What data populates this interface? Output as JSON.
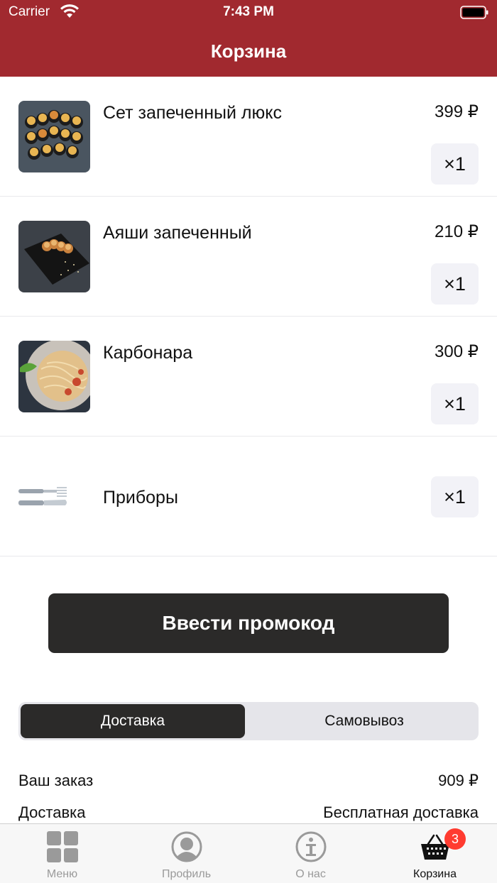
{
  "status_bar": {
    "carrier": "Carrier",
    "time": "7:43 PM"
  },
  "header": {
    "title": "Корзина"
  },
  "cart": {
    "items": [
      {
        "name": "Сет запеченный люкс",
        "price": "399 ₽",
        "quantity": "×1",
        "image": "baked-sushi-set-photo"
      },
      {
        "name": "Аяши запеченный",
        "price": "210 ₽",
        "quantity": "×1",
        "image": "baked-roll-plate-photo"
      },
      {
        "name": "Карбонара",
        "price": "300 ₽",
        "quantity": "×1",
        "image": "carbonara-pasta-photo"
      },
      {
        "name": "Приборы",
        "price": "",
        "quantity": "×1",
        "image": "fork-knife-icon"
      }
    ]
  },
  "promo": {
    "label": "Ввести промокод"
  },
  "delivery_toggle": {
    "options": [
      "Доставка",
      "Самовывоз"
    ],
    "selected": "Доставка"
  },
  "summary": {
    "order_label": "Ваш заказ",
    "order_value": "909 ₽",
    "delivery_label": "Доставка",
    "delivery_value": "Бесплатная доставка"
  },
  "tabbar": {
    "tabs": [
      {
        "label": "Меню",
        "icon": "grid-icon"
      },
      {
        "label": "Профиль",
        "icon": "profile-icon"
      },
      {
        "label": "О нас",
        "icon": "info-icon"
      },
      {
        "label": "Корзина",
        "icon": "basket-icon",
        "badge": "3"
      }
    ],
    "active": "Корзина"
  },
  "colors": {
    "header_bg": "#a1292f",
    "dark_button": "#2b2a29",
    "badge": "#ff3b30"
  }
}
